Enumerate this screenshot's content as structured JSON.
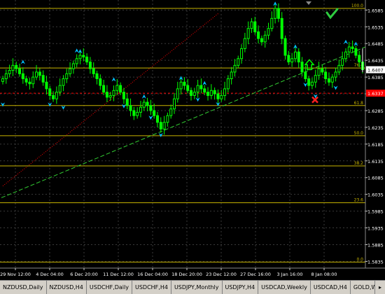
{
  "chart_data": {
    "type": "candlestick",
    "ylim": [
      1.5815,
      1.6615
    ],
    "y_ticks": [
      "1.6585",
      "1.6535",
      "1.6485",
      "1.6435",
      "1.6385",
      "1.6335",
      "1.6285",
      "1.6235",
      "1.6185",
      "1.6135",
      "1.6085",
      "1.6035",
      "1.5985",
      "1.5935",
      "1.5885",
      "1.5835"
    ],
    "x_ticks": [
      "29 Nov 12:00",
      "4 Dec 04:00",
      "6 Dec 20:00",
      "11 Dec 12:00",
      "16 Dec 04:00",
      "18 Dec 20:00",
      "23 Dec 12:00",
      "27 Dec 16:00",
      "3 Jan 16:00",
      "8 Jan 08:00"
    ],
    "current_price": "1.6407",
    "alert_price": "1.6337",
    "fib_levels": [
      {
        "label": "100.0",
        "price": 1.659
      },
      {
        "label": "76.4",
        "price": 1.6412
      },
      {
        "label": "61.8",
        "price": 1.63
      },
      {
        "label": "50.0",
        "price": 1.621
      },
      {
        "label": "38.2",
        "price": 1.612
      },
      {
        "label": "23.6",
        "price": 1.601
      },
      {
        "label": "0.0",
        "price": 1.5833
      }
    ],
    "closes": [
      1.638,
      1.6395,
      1.6405,
      1.642,
      1.641,
      1.6395,
      1.638,
      1.637,
      1.6365,
      1.6385,
      1.64,
      1.639,
      1.637,
      1.635,
      1.633,
      1.632,
      1.634,
      1.636,
      1.638,
      1.6395,
      1.641,
      1.6425,
      1.644,
      1.645,
      1.6445,
      1.643,
      1.641,
      1.6395,
      1.638,
      1.636,
      1.634,
      1.6325,
      1.633,
      1.6345,
      1.636,
      1.634,
      1.632,
      1.63,
      1.6285,
      1.627,
      1.628,
      1.6295,
      1.631,
      1.63,
      1.6285,
      1.627,
      1.625,
      1.623,
      1.625,
      1.627,
      1.629,
      1.632,
      1.635,
      1.637,
      1.636,
      1.6345,
      1.633,
      1.634,
      1.636,
      1.635,
      1.634,
      1.633,
      1.6345,
      1.6335,
      1.632,
      1.633,
      1.635,
      1.638,
      1.64,
      1.642,
      1.644,
      1.647,
      1.65,
      1.653,
      1.655,
      1.652,
      1.65,
      1.649,
      1.651,
      1.653,
      1.656,
      1.659,
      1.656,
      1.65,
      1.645,
      1.643,
      1.644,
      1.646,
      1.643,
      1.64,
      1.638,
      1.636,
      1.637,
      1.639,
      1.641,
      1.64,
      1.638,
      1.637,
      1.6385,
      1.64,
      1.642,
      1.644,
      1.646,
      1.6475,
      1.647,
      1.645,
      1.643,
      1.6407
    ]
  },
  "indicators": {
    "up_arrows": [
      {
        "i": 6,
        "p": 1.6428
      },
      {
        "i": 22,
        "p": 1.6462
      },
      {
        "i": 23,
        "p": 1.646
      },
      {
        "i": 53,
        "p": 1.638
      },
      {
        "i": 60,
        "p": 1.6365
      },
      {
        "i": 81,
        "p": 1.6602
      },
      {
        "i": 87,
        "p": 1.6474
      },
      {
        "i": 102,
        "p": 1.6488
      },
      {
        "i": 105,
        "p": 1.6482
      },
      {
        "i": 33,
        "p": 1.6376
      },
      {
        "i": 42,
        "p": 1.6325
      }
    ],
    "down_arrows": [
      {
        "i": 0,
        "p": 1.6305
      },
      {
        "i": 14,
        "p": 1.6305
      },
      {
        "i": 18,
        "p": 1.6296
      },
      {
        "i": 36,
        "p": 1.63
      },
      {
        "i": 44,
        "p": 1.6266
      },
      {
        "i": 47,
        "p": 1.6214
      },
      {
        "i": 58,
        "p": 1.632
      },
      {
        "i": 64,
        "p": 1.6306
      },
      {
        "i": 90,
        "p": 1.6364
      },
      {
        "i": 93,
        "p": 1.633
      },
      {
        "i": 99,
        "p": 1.6355
      }
    ]
  },
  "marks": {
    "check_icon": "check-icon",
    "cross_icon": "cross-icon",
    "up_arrow_icon": "hollow-up-arrow-icon"
  },
  "colors": {
    "candle": "#00ff00",
    "fib": "#c8b400",
    "trendline": "#32cd32",
    "redline": "#ff0000",
    "arrows": "#00bfff",
    "price_box": "#ffffff",
    "alert_box": "#ff0000"
  },
  "tabs": [
    "NZDUSD,Daily",
    "NZDUSD,H4",
    "USDCHF,Daily",
    "USDCHF,H4",
    "USDJPY,Monthly",
    "USDJPY,H4",
    "USDCAD,Weekly",
    "USDCAD,H4",
    "GOLD,Weekly"
  ]
}
